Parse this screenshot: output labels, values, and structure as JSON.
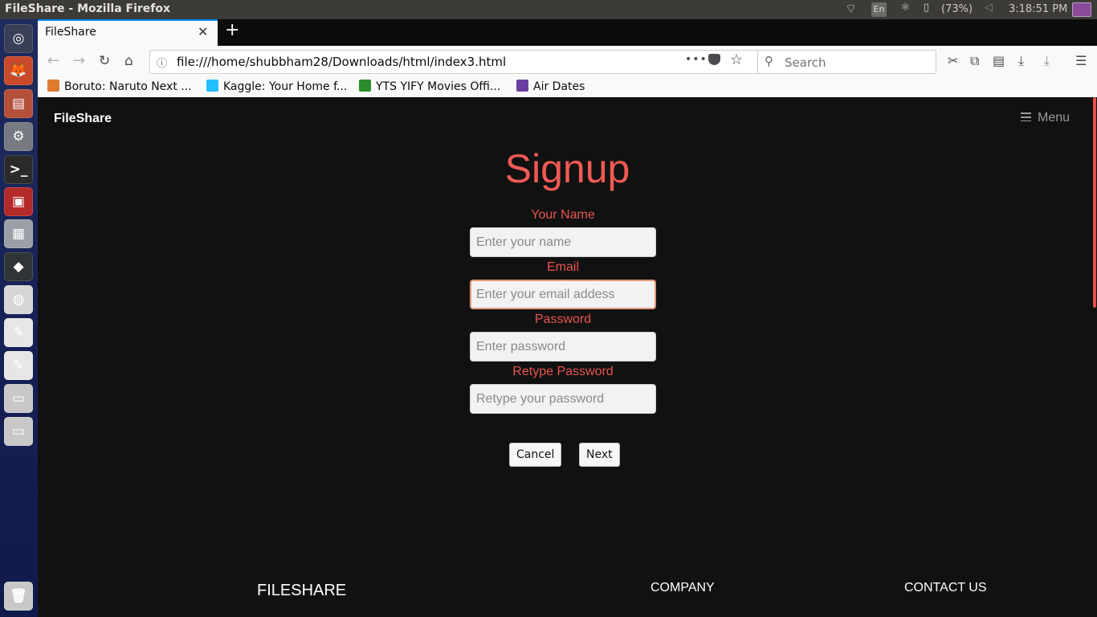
{
  "os": {
    "window_title": "FileShare - Mozilla Firefox",
    "keyboard_layout": "En",
    "battery": "(73%)",
    "clock": "3:18:51 PM"
  },
  "launcher": {
    "apps": [
      {
        "name": "ubuntu-dash-icon",
        "glyph": "◎",
        "color": "#3a3f58"
      },
      {
        "name": "firefox-icon",
        "glyph": "🦊",
        "color": "#c94a2a"
      },
      {
        "name": "files-icon",
        "glyph": "▤",
        "color": "#b4503a"
      },
      {
        "name": "settings-icon",
        "glyph": "⚙",
        "color": "#777a80"
      },
      {
        "name": "terminal-icon",
        "glyph": ">_",
        "color": "#2b2b2b"
      },
      {
        "name": "app-red-icon",
        "glyph": "▣",
        "color": "#b42a2a"
      },
      {
        "name": "app-gray-icon",
        "glyph": "▦",
        "color": "#9aa0a6"
      },
      {
        "name": "app-dark-icon",
        "glyph": "◆",
        "color": "#303437"
      },
      {
        "name": "app-chart-icon",
        "glyph": "◍",
        "color": "#d6d6d6"
      },
      {
        "name": "text-editor-icon",
        "glyph": "✎",
        "color": "#e6e6e6"
      },
      {
        "name": "text-editor-2-icon",
        "glyph": "✎",
        "color": "#e6e6e6"
      },
      {
        "name": "drive-icon",
        "glyph": "▭",
        "color": "#c8c8c8"
      },
      {
        "name": "drive-2-icon",
        "glyph": "▭",
        "color": "#c8c8c8"
      },
      {
        "name": "trash-icon",
        "glyph": "🗑",
        "color": "#c8c8c8"
      }
    ]
  },
  "browser": {
    "tab_title": "FileShare",
    "url": "file:///home/shubbham28/Downloads/html/index3.html",
    "search_placeholder": "Search",
    "bookmarks": [
      {
        "label": "Boruto: Naruto Next ...",
        "color": "#e07a2f"
      },
      {
        "label": "Kaggle: Your Home f...",
        "color": "#20beff"
      },
      {
        "label": "YTS YIFY Movies Offi...",
        "color": "#2b8a2b"
      },
      {
        "label": "Air Dates",
        "color": "#6a3fa0"
      }
    ]
  },
  "page": {
    "brand": "FileShare",
    "menu_label": "Menu",
    "title": "Signup",
    "fields": {
      "name_label": "Your Name",
      "name_placeholder": "Enter your name",
      "email_label": "Email",
      "email_placeholder": "Enter your email addess",
      "password_label": "Password",
      "password_placeholder": "Enter password",
      "retype_label": "Retype Password",
      "retype_placeholder": "Retype your password"
    },
    "buttons": {
      "cancel": "Cancel",
      "next": "Next"
    },
    "footer": {
      "brand": "FILESHARE",
      "company": "COMPANY",
      "contact": "CONTACT US"
    }
  },
  "colors": {
    "accent": "#ef5a54",
    "background": "#111111"
  }
}
